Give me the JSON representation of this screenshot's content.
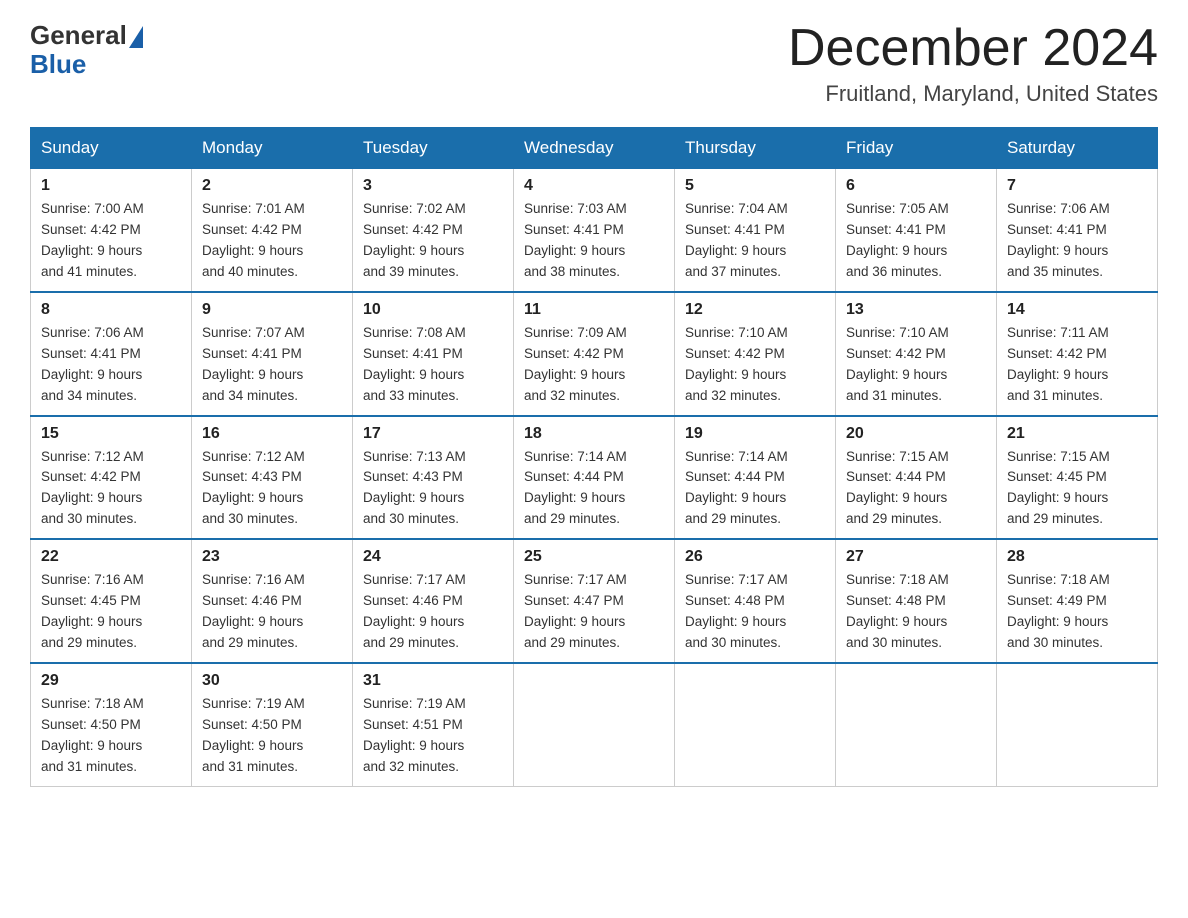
{
  "logo": {
    "general": "General",
    "blue": "Blue"
  },
  "title": "December 2024",
  "location": "Fruitland, Maryland, United States",
  "days_of_week": [
    "Sunday",
    "Monday",
    "Tuesday",
    "Wednesday",
    "Thursday",
    "Friday",
    "Saturday"
  ],
  "weeks": [
    [
      {
        "day": "1",
        "sunrise": "7:00 AM",
        "sunset": "4:42 PM",
        "daylight": "9 hours and 41 minutes."
      },
      {
        "day": "2",
        "sunrise": "7:01 AM",
        "sunset": "4:42 PM",
        "daylight": "9 hours and 40 minutes."
      },
      {
        "day": "3",
        "sunrise": "7:02 AM",
        "sunset": "4:42 PM",
        "daylight": "9 hours and 39 minutes."
      },
      {
        "day": "4",
        "sunrise": "7:03 AM",
        "sunset": "4:41 PM",
        "daylight": "9 hours and 38 minutes."
      },
      {
        "day": "5",
        "sunrise": "7:04 AM",
        "sunset": "4:41 PM",
        "daylight": "9 hours and 37 minutes."
      },
      {
        "day": "6",
        "sunrise": "7:05 AM",
        "sunset": "4:41 PM",
        "daylight": "9 hours and 36 minutes."
      },
      {
        "day": "7",
        "sunrise": "7:06 AM",
        "sunset": "4:41 PM",
        "daylight": "9 hours and 35 minutes."
      }
    ],
    [
      {
        "day": "8",
        "sunrise": "7:06 AM",
        "sunset": "4:41 PM",
        "daylight": "9 hours and 34 minutes."
      },
      {
        "day": "9",
        "sunrise": "7:07 AM",
        "sunset": "4:41 PM",
        "daylight": "9 hours and 34 minutes."
      },
      {
        "day": "10",
        "sunrise": "7:08 AM",
        "sunset": "4:41 PM",
        "daylight": "9 hours and 33 minutes."
      },
      {
        "day": "11",
        "sunrise": "7:09 AM",
        "sunset": "4:42 PM",
        "daylight": "9 hours and 32 minutes."
      },
      {
        "day": "12",
        "sunrise": "7:10 AM",
        "sunset": "4:42 PM",
        "daylight": "9 hours and 32 minutes."
      },
      {
        "day": "13",
        "sunrise": "7:10 AM",
        "sunset": "4:42 PM",
        "daylight": "9 hours and 31 minutes."
      },
      {
        "day": "14",
        "sunrise": "7:11 AM",
        "sunset": "4:42 PM",
        "daylight": "9 hours and 31 minutes."
      }
    ],
    [
      {
        "day": "15",
        "sunrise": "7:12 AM",
        "sunset": "4:42 PM",
        "daylight": "9 hours and 30 minutes."
      },
      {
        "day": "16",
        "sunrise": "7:12 AM",
        "sunset": "4:43 PM",
        "daylight": "9 hours and 30 minutes."
      },
      {
        "day": "17",
        "sunrise": "7:13 AM",
        "sunset": "4:43 PM",
        "daylight": "9 hours and 30 minutes."
      },
      {
        "day": "18",
        "sunrise": "7:14 AM",
        "sunset": "4:44 PM",
        "daylight": "9 hours and 29 minutes."
      },
      {
        "day": "19",
        "sunrise": "7:14 AM",
        "sunset": "4:44 PM",
        "daylight": "9 hours and 29 minutes."
      },
      {
        "day": "20",
        "sunrise": "7:15 AM",
        "sunset": "4:44 PM",
        "daylight": "9 hours and 29 minutes."
      },
      {
        "day": "21",
        "sunrise": "7:15 AM",
        "sunset": "4:45 PM",
        "daylight": "9 hours and 29 minutes."
      }
    ],
    [
      {
        "day": "22",
        "sunrise": "7:16 AM",
        "sunset": "4:45 PM",
        "daylight": "9 hours and 29 minutes."
      },
      {
        "day": "23",
        "sunrise": "7:16 AM",
        "sunset": "4:46 PM",
        "daylight": "9 hours and 29 minutes."
      },
      {
        "day": "24",
        "sunrise": "7:17 AM",
        "sunset": "4:46 PM",
        "daylight": "9 hours and 29 minutes."
      },
      {
        "day": "25",
        "sunrise": "7:17 AM",
        "sunset": "4:47 PM",
        "daylight": "9 hours and 29 minutes."
      },
      {
        "day": "26",
        "sunrise": "7:17 AM",
        "sunset": "4:48 PM",
        "daylight": "9 hours and 30 minutes."
      },
      {
        "day": "27",
        "sunrise": "7:18 AM",
        "sunset": "4:48 PM",
        "daylight": "9 hours and 30 minutes."
      },
      {
        "day": "28",
        "sunrise": "7:18 AM",
        "sunset": "4:49 PM",
        "daylight": "9 hours and 30 minutes."
      }
    ],
    [
      {
        "day": "29",
        "sunrise": "7:18 AM",
        "sunset": "4:50 PM",
        "daylight": "9 hours and 31 minutes."
      },
      {
        "day": "30",
        "sunrise": "7:19 AM",
        "sunset": "4:50 PM",
        "daylight": "9 hours and 31 minutes."
      },
      {
        "day": "31",
        "sunrise": "7:19 AM",
        "sunset": "4:51 PM",
        "daylight": "9 hours and 32 minutes."
      },
      null,
      null,
      null,
      null
    ]
  ]
}
